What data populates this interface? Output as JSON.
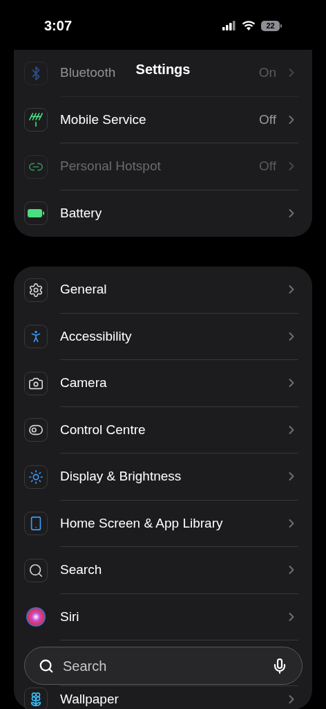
{
  "status_bar": {
    "time": "3:07",
    "battery": "22"
  },
  "header": {
    "title": "Settings"
  },
  "groups": [
    {
      "items": [
        {
          "label": "Bluetooth",
          "value": "On",
          "disabled": false,
          "blurred": true
        },
        {
          "label": "Mobile Service",
          "value": "Off",
          "disabled": false,
          "blurred": false
        },
        {
          "label": "Personal Hotspot",
          "value": "Off",
          "disabled": true,
          "blurred": false
        },
        {
          "label": "Battery",
          "disabled": false,
          "blurred": false
        }
      ]
    },
    {
      "items": [
        {
          "label": "General",
          "disabled": false,
          "blurred": false
        },
        {
          "label": "Accessibility",
          "disabled": false,
          "blurred": false
        },
        {
          "label": "Camera",
          "disabled": false,
          "blurred": false
        },
        {
          "label": "Control Centre",
          "disabled": false,
          "blurred": false
        },
        {
          "label": "Display & Brightness",
          "disabled": false,
          "blurred": false
        },
        {
          "label": "Home Screen & App Library",
          "disabled": false,
          "blurred": false
        },
        {
          "label": "Search",
          "disabled": false,
          "blurred": false
        },
        {
          "label": "Siri",
          "disabled": false,
          "blurred": false
        },
        {
          "label": "Wallpaper",
          "disabled": false,
          "blurred": false
        }
      ]
    }
  ],
  "search_bar": {
    "placeholder": "Search"
  }
}
